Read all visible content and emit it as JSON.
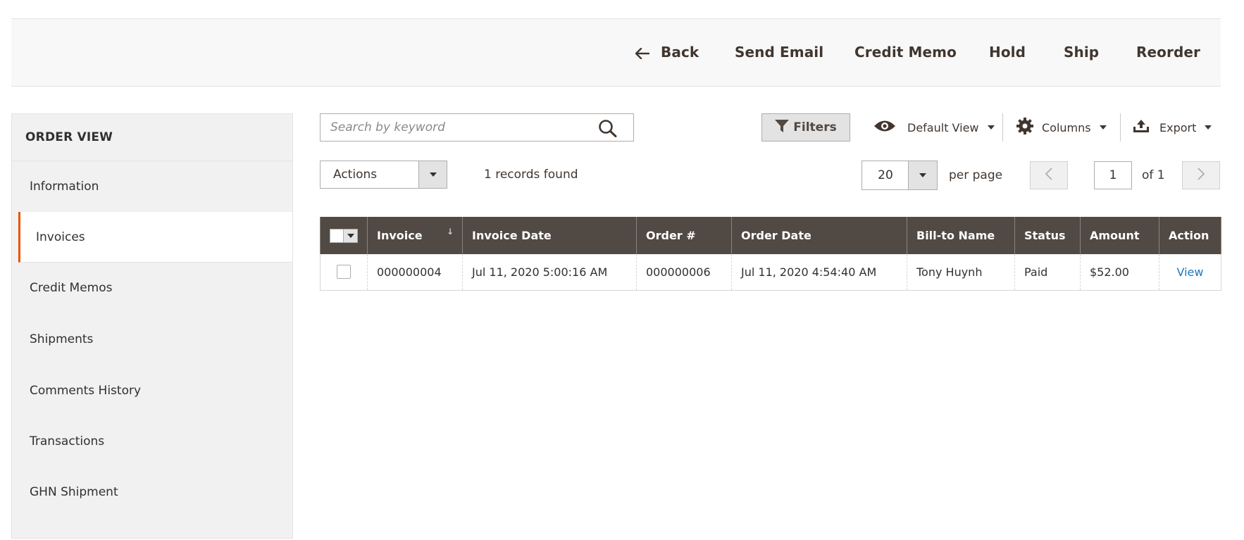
{
  "page_actions": {
    "back": "Back",
    "send_email": "Send Email",
    "credit_memo": "Credit Memo",
    "hold": "Hold",
    "ship": "Ship",
    "reorder": "Reorder"
  },
  "sidebar": {
    "title": "ORDER VIEW",
    "active_index": 1,
    "accent_color": "#eb5202",
    "items": [
      {
        "label": "Information"
      },
      {
        "label": "Invoices"
      },
      {
        "label": "Credit Memos"
      },
      {
        "label": "Shipments"
      },
      {
        "label": "Comments History"
      },
      {
        "label": "Transactions"
      },
      {
        "label": "GHN Shipment"
      }
    ]
  },
  "toolbar": {
    "search_placeholder": "Search by keyword",
    "search_value": "",
    "filters_label": "Filters",
    "view_label": "Default View",
    "columns_label": "Columns",
    "export_label": "Export",
    "actions_label": "Actions",
    "records_found": "1 records found",
    "per_page_value": "20",
    "per_page_label": "per page",
    "current_page": "1",
    "page_of": "of 1"
  },
  "grid": {
    "header_color": "#514943",
    "link_color": "#1979c3",
    "columns": [
      {
        "label": "Invoice",
        "sorted": "desc"
      },
      {
        "label": "Invoice Date"
      },
      {
        "label": "Order #"
      },
      {
        "label": "Order Date"
      },
      {
        "label": "Bill-to Name"
      },
      {
        "label": "Status"
      },
      {
        "label": "Amount"
      },
      {
        "label": "Action"
      }
    ],
    "sort_indicator": "↓",
    "rows": [
      {
        "invoice": "000000004",
        "invoice_date": "Jul 11, 2020 5:00:16 AM",
        "order_number": "000000006",
        "order_date": "Jul 11, 2020 4:54:40 AM",
        "bill_to_name": "Tony Huynh",
        "status": "Paid",
        "amount": "$52.00",
        "action": "View"
      }
    ]
  }
}
